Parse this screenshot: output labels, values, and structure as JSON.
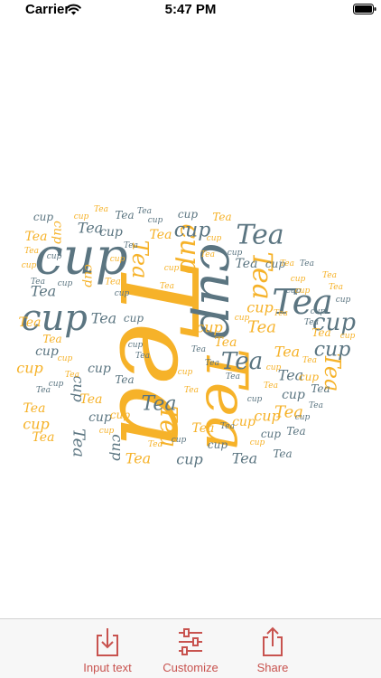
{
  "status_bar": {
    "carrier": "Carrier",
    "time": "5:47 PM",
    "icons": [
      "wifi-icon",
      "battery-icon"
    ]
  },
  "word_cloud": {
    "words": [
      "Tea",
      "cup"
    ],
    "colors": {
      "primary": "#f6b229",
      "secondary": "#5b7581"
    },
    "shape": "teacup"
  },
  "tab_bar": {
    "accent_color": "#c8534f",
    "items": [
      {
        "label": "Input text",
        "icon": "import-icon"
      },
      {
        "label": "Customize",
        "icon": "sliders-icon"
      },
      {
        "label": "Share",
        "icon": "share-icon"
      }
    ]
  }
}
